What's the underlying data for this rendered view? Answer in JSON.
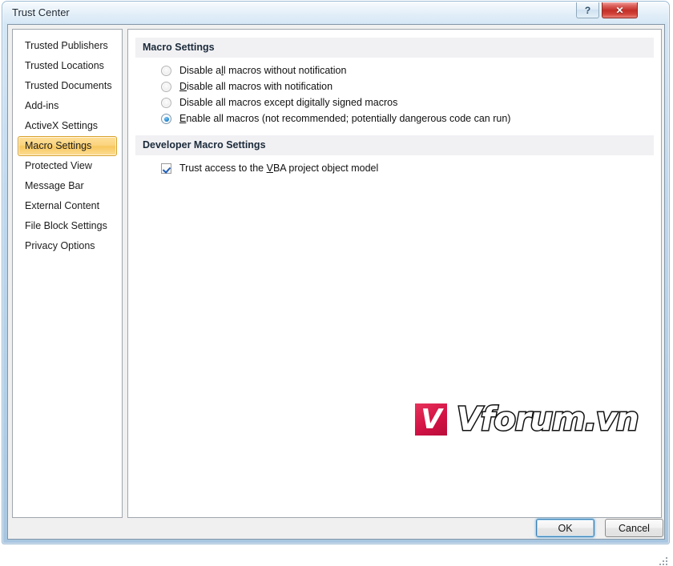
{
  "window": {
    "title": "Trust Center",
    "help_button": "?",
    "close_button": "✕"
  },
  "sidebar": {
    "items": [
      {
        "label": "Trusted Publishers",
        "selected": false
      },
      {
        "label": "Trusted Locations",
        "selected": false
      },
      {
        "label": "Trusted Documents",
        "selected": false
      },
      {
        "label": "Add-ins",
        "selected": false
      },
      {
        "label": "ActiveX Settings",
        "selected": false
      },
      {
        "label": "Macro Settings",
        "selected": true
      },
      {
        "label": "Protected View",
        "selected": false
      },
      {
        "label": "Message Bar",
        "selected": false
      },
      {
        "label": "External Content",
        "selected": false
      },
      {
        "label": "File Block Settings",
        "selected": false
      },
      {
        "label": "Privacy Options",
        "selected": false
      }
    ]
  },
  "macro_settings": {
    "header": "Macro Settings",
    "options": [
      {
        "pre": "Disable a",
        "accel": "l",
        "post": "l macros without notification",
        "selected": false
      },
      {
        "pre": "",
        "accel": "D",
        "post": "isable all macros with notification",
        "selected": false
      },
      {
        "pre": "Disable all macros except di",
        "accel": "g",
        "post": "itally signed macros",
        "selected": false
      },
      {
        "pre": "",
        "accel": "E",
        "post": "nable all macros (not recommended; potentially dangerous code can run)",
        "selected": true
      }
    ]
  },
  "developer_macro_settings": {
    "header": "Developer Macro Settings",
    "checkbox": {
      "pre": "Trust access to the ",
      "accel": "V",
      "post": "BA project object model",
      "checked": true
    }
  },
  "footer": {
    "ok_label": "OK",
    "cancel_label": "Cancel"
  },
  "watermark": {
    "mark_letter": "V",
    "text": "Vforum.vn",
    "brand_color": "#d31245"
  }
}
